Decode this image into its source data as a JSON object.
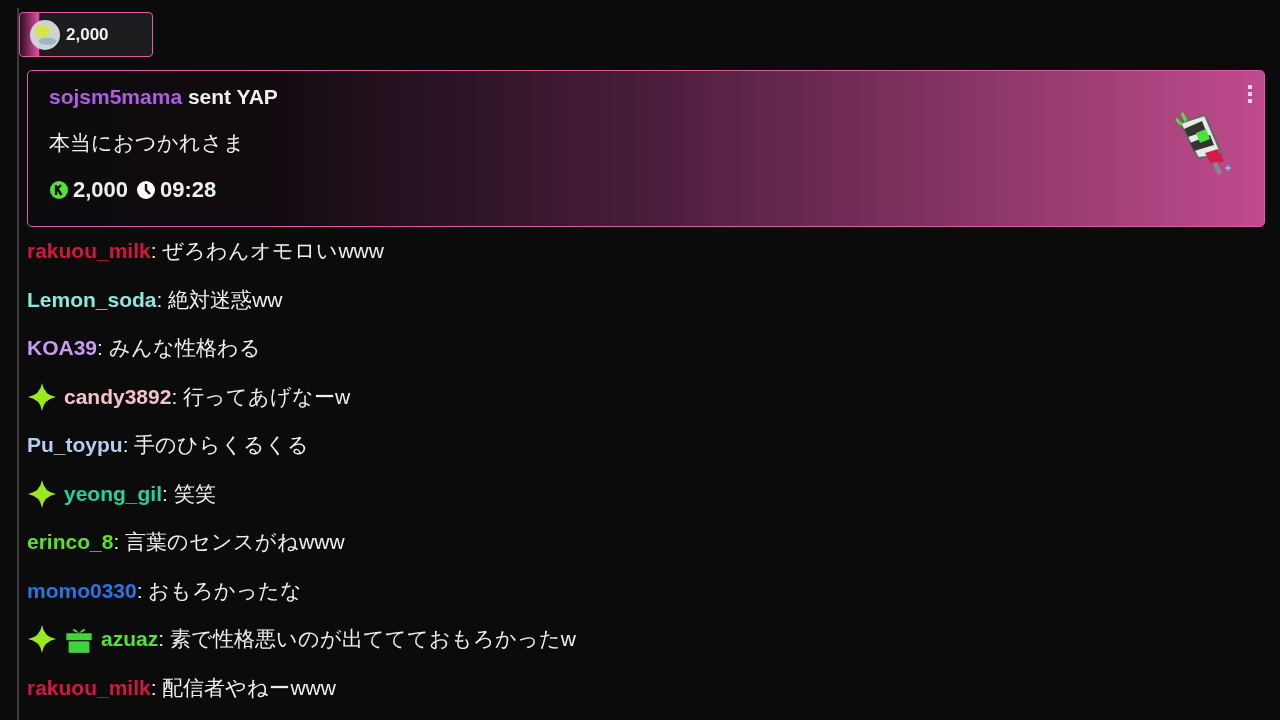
{
  "balance": {
    "amount": "2,000"
  },
  "donation": {
    "user": "sojsm5mama",
    "action": "sent YAP",
    "message": "本当におつかれさま",
    "amount": "2,000",
    "time": "09:28"
  },
  "messages": [
    {
      "user": "rakuou_milk",
      "color": "#d4173f",
      "text": ": ぜろわんオモロいwww"
    },
    {
      "user": "Lemon_soda",
      "color": "#8ee6dc",
      "text": ": 絶対迷惑ww"
    },
    {
      "user": "KOA39",
      "color": "#c99af0",
      "text": ": みんな性格わる"
    },
    {
      "user": "candy3892",
      "color": "#f5c2c8",
      "badges": [
        {
          "kind": "sparkle"
        }
      ],
      "text": ": 行ってあげなーw"
    },
    {
      "user": "Pu_toypu",
      "color": "#b3cdf0",
      "text": ": 手のひらくるくる"
    },
    {
      "user": "yeong_gil",
      "color": "#1fd39a",
      "badges": [
        {
          "kind": "sparkle"
        }
      ],
      "text": ": 笑笑"
    },
    {
      "user": "erinco_8",
      "color": "#5be02e",
      "text": ": 言葉のセンスがねwww"
    },
    {
      "user": "momo0330",
      "color": "#2a73e0",
      "text": ": おもろかったな"
    },
    {
      "user": "azuaz",
      "color": "#56e03a",
      "badges": [
        {
          "kind": "sparkle"
        },
        {
          "kind": "gift"
        }
      ],
      "text": ": 素で性格悪いのが出ててておもろかったw"
    },
    {
      "user": "rakuou_milk",
      "color": "#d4173f",
      "text": ": 配信者やねーwww"
    }
  ]
}
